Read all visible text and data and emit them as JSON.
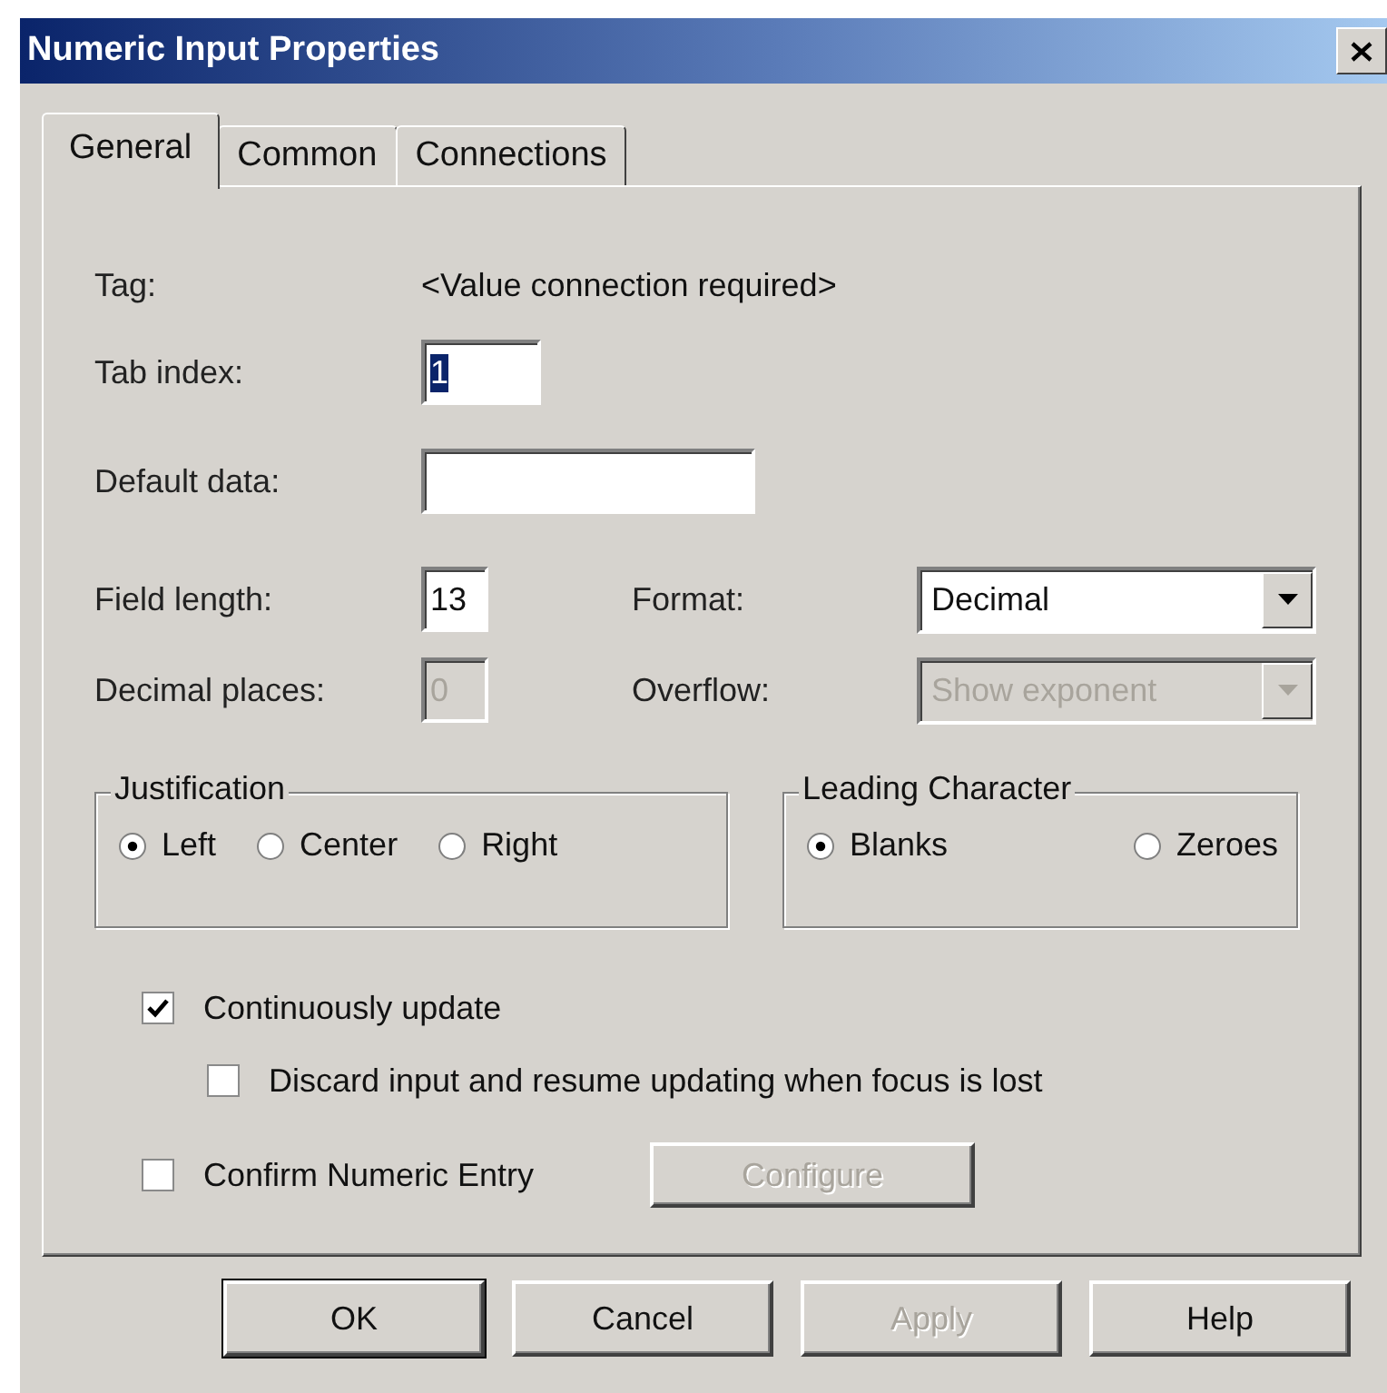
{
  "window": {
    "title": "Numeric Input Properties"
  },
  "tabs": [
    {
      "label": "General",
      "selected": true
    },
    {
      "label": "Common",
      "selected": false
    },
    {
      "label": "Connections",
      "selected": false
    }
  ],
  "tag": {
    "label": "Tag:",
    "value": "<Value connection required>"
  },
  "tab_index": {
    "label": "Tab index:",
    "value": "1",
    "text_selected": true
  },
  "default_data": {
    "label": "Default data:"
  },
  "field_length": {
    "label": "Field length:",
    "value": "13",
    "disabled": false
  },
  "format": {
    "label": "Format:",
    "value": "Decimal",
    "disabled": false
  },
  "decimal_places": {
    "label": "Decimal places:",
    "value": "0",
    "disabled": true
  },
  "overflow": {
    "label": "Overflow:",
    "value": "Show exponent",
    "disabled": true
  },
  "groups": [
    {
      "title": "Justification",
      "options": [
        {
          "label": "Left",
          "selected": true
        },
        {
          "label": "Center",
          "selected": false
        },
        {
          "label": "Right",
          "selected": false
        }
      ]
    },
    {
      "title": "Leading Character",
      "options": [
        {
          "label": "Blanks",
          "selected": true
        },
        {
          "label": "Zeroes",
          "selected": false
        }
      ]
    }
  ],
  "checkboxes": [
    {
      "label": "Continuously update",
      "checked": true,
      "children": [
        {
          "label": "Discard input and resume updating when focus is lost",
          "checked": false
        }
      ]
    },
    {
      "label": "Confirm Numeric Entry",
      "checked": false,
      "button": {
        "label": "Configure",
        "disabled": true
      }
    }
  ],
  "buttons": [
    {
      "label": "OK",
      "default": true,
      "disabled": false
    },
    {
      "label": "Cancel",
      "default": false,
      "disabled": false
    },
    {
      "label": "Apply",
      "default": false,
      "disabled": true
    },
    {
      "label": "Help",
      "default": false,
      "disabled": false
    }
  ]
}
